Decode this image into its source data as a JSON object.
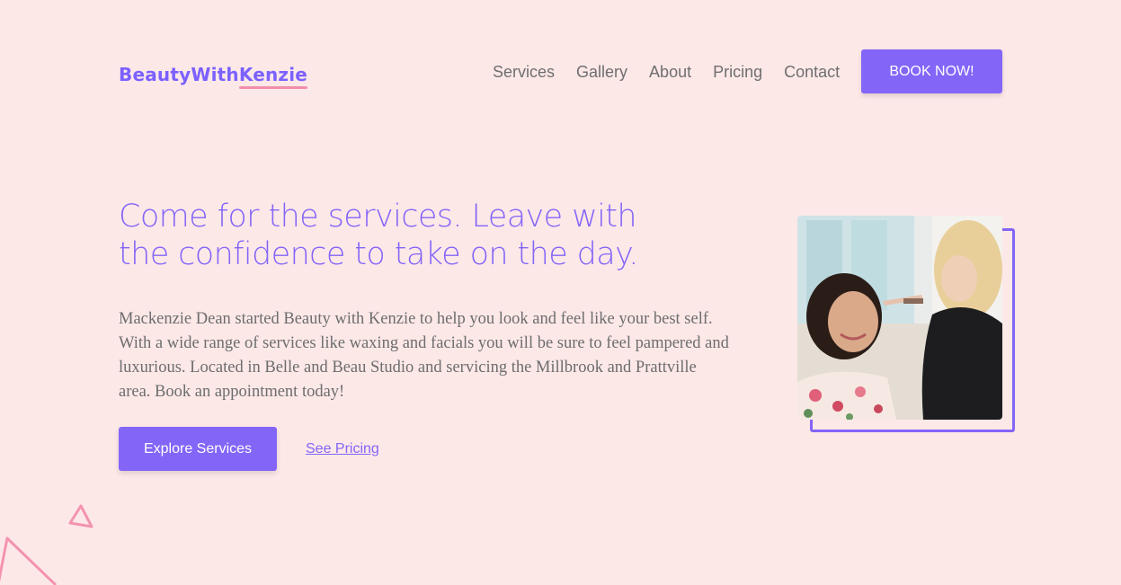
{
  "brand": {
    "name_part1": "BeautyWith",
    "name_part2": "Kenzie"
  },
  "nav": {
    "items": [
      "Services",
      "Gallery",
      "About",
      "Pricing",
      "Contact"
    ],
    "cta_label": "BOOK NOW!"
  },
  "hero": {
    "headline": "Come for the services. Leave with the confidence to take on the day.",
    "paragraph": "Mackenzie Dean started Beauty with Kenzie to help you look and feel like your best self. With a wide range of services like waxing and facials you will be sure to feel pampered and luxurious. Located in Belle and Beau Studio and servicing the Millbrook and Prattville area. Book an appointment today!",
    "primary_button": "Explore Services",
    "secondary_link": "See Pricing"
  },
  "colors": {
    "background": "#fde8e8",
    "accent": "#8365f7",
    "pink": "#f08fab"
  }
}
